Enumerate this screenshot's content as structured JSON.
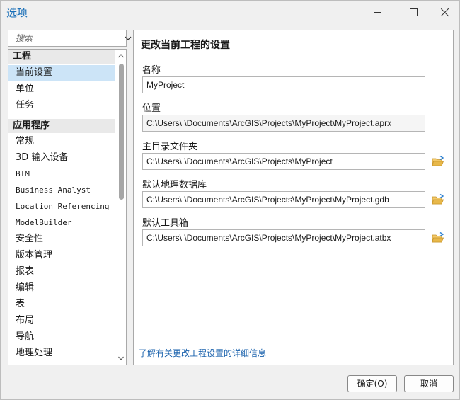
{
  "window": {
    "title": "选项"
  },
  "search": {
    "placeholder": "搜索"
  },
  "nav": {
    "sections": [
      {
        "header": "工程",
        "items": [
          "当前设置",
          "单位",
          "任务"
        ]
      },
      {
        "header": "应用程序",
        "items": [
          "常规",
          "3D 输入设备",
          "BIM",
          "Business Analyst",
          "Location Referencing",
          "ModelBuilder",
          "安全性",
          "版本管理",
          "报表",
          "编辑",
          "表",
          "布局",
          "导航",
          "地理处理"
        ]
      }
    ],
    "selected": "当前设置"
  },
  "panel": {
    "title": "更改当前工程的设置",
    "fields": [
      {
        "label": "名称",
        "value": "MyProject"
      },
      {
        "label": "位置",
        "value": "C:\\Users\\        \\Documents\\ArcGIS\\Projects\\MyProject\\MyProject.aprx"
      },
      {
        "label": "主目录文件夹",
        "value": "C:\\Users\\        \\Documents\\ArcGIS\\Projects\\MyProject"
      },
      {
        "label": "默认地理数据库",
        "value": "C:\\Users\\        \\Documents\\ArcGIS\\Projects\\MyProject\\MyProject.gdb"
      },
      {
        "label": "默认工具箱",
        "value": "C:\\Users\\        \\Documents\\ArcGIS\\Projects\\MyProject\\MyProject.atbx"
      }
    ],
    "learn_more": "了解有关更改工程设置的详细信息"
  },
  "buttons": {
    "ok": "确定(O)",
    "cancel": "取消"
  },
  "colors": {
    "title": "#1a6fb8",
    "selected_bg": "#cce4f7",
    "link": "#1a62ad",
    "folder": "#e8b84a"
  }
}
